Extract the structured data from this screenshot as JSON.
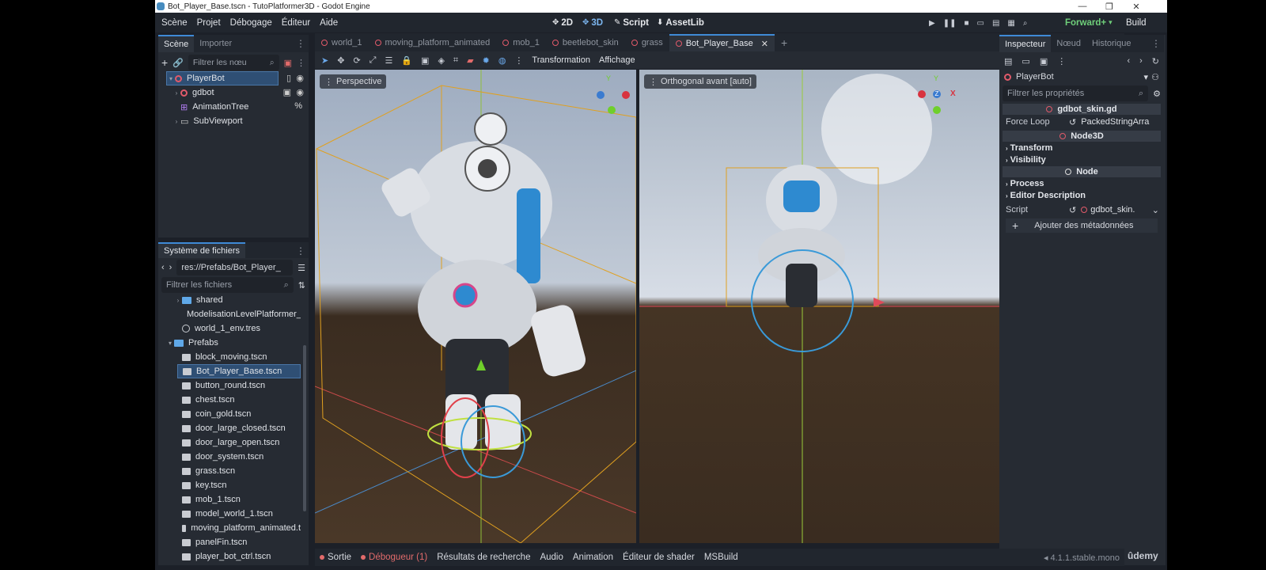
{
  "window": {
    "title": "Bot_Player_Base.tscn - TutoPlatformer3D - Godot Engine"
  },
  "menu": [
    "Scène",
    "Projet",
    "Débogage",
    "Éditeur",
    "Aide"
  ],
  "modes": {
    "m2d": "2D",
    "m3d": "3D",
    "script": "Script",
    "assetlib": "AssetLib"
  },
  "renderer": "Forward+",
  "build_label": "Build",
  "scene_panel": {
    "tabs": [
      "Scène",
      "Importer"
    ],
    "filter_placeholder": "Filtrer les nœu",
    "nodes": [
      {
        "label": "PlayerBot"
      },
      {
        "label": "gdbot"
      },
      {
        "label": "AnimationTree",
        "badge": "%"
      },
      {
        "label": "SubViewport"
      }
    ]
  },
  "filesystem": {
    "title": "Système de fichiers",
    "path": "res://Prefabs/Bot_Player_",
    "filter_placeholder": "Filtrer les fichiers",
    "items": [
      {
        "label": "shared",
        "kind": "folder"
      },
      {
        "label": "ModelisationLevelPlatformer_",
        "kind": "file"
      },
      {
        "label": "world_1_env.tres",
        "kind": "res"
      },
      {
        "label": "Prefabs",
        "kind": "folder"
      },
      {
        "label": "block_moving.tscn",
        "kind": "file"
      },
      {
        "label": "Bot_Player_Base.tscn",
        "kind": "file"
      },
      {
        "label": "button_round.tscn",
        "kind": "file"
      },
      {
        "label": "chest.tscn",
        "kind": "file"
      },
      {
        "label": "coin_gold.tscn",
        "kind": "file"
      },
      {
        "label": "door_large_closed.tscn",
        "kind": "file"
      },
      {
        "label": "door_large_open.tscn",
        "kind": "file"
      },
      {
        "label": "door_system.tscn",
        "kind": "file"
      },
      {
        "label": "grass.tscn",
        "kind": "file"
      },
      {
        "label": "key.tscn",
        "kind": "file"
      },
      {
        "label": "mob_1.tscn",
        "kind": "file"
      },
      {
        "label": "model_world_1.tscn",
        "kind": "file"
      },
      {
        "label": "moving_platform_animated.t",
        "kind": "file"
      },
      {
        "label": "panelFin.tscn",
        "kind": "file"
      },
      {
        "label": "player_bot_ctrl.tscn",
        "kind": "file"
      }
    ]
  },
  "scene_tabs": [
    "world_1",
    "moving_platform_animated",
    "mob_1",
    "beetlebot_skin",
    "grass",
    "Bot_Player_Base"
  ],
  "toolbar": {
    "transform_label": "Transformation",
    "view_label": "Affichage"
  },
  "viewports": {
    "left": {
      "label": "Perspective"
    },
    "right": {
      "label": "Orthogonal avant [auto]"
    },
    "axes": {
      "y": "Y",
      "z": "Z",
      "x": "X"
    }
  },
  "inspector": {
    "tabs": [
      "Inspecteur",
      "Nœud",
      "Historique"
    ],
    "node_name": "PlayerBot",
    "filter_placeholder": "Filtrer les propriétés",
    "script_section": "gdbot_skin.gd",
    "force_loop_label": "Force Loop",
    "force_loop_value": "PackedStringArra",
    "node3d_section": "Node3D",
    "transform_group": "Transform",
    "visibility_group": "Visibility",
    "node_section": "Node",
    "process_group": "Process",
    "editor_desc_group": "Editor Description",
    "script_label": "Script",
    "script_value": "gdbot_skin.",
    "add_meta": "Ajouter des métadonnées"
  },
  "bottom_tabs": [
    "Sortie",
    "Débogueur (1)",
    "Résultats de recherche",
    "Audio",
    "Animation",
    "Éditeur de shader",
    "MSBuild"
  ],
  "version": "4.1.1.stable.mono",
  "watermark": "ûdemy",
  "colors": {
    "accent": "#3f8ad6",
    "node_ring": "#e15a6a",
    "selection": "#2f4f74"
  }
}
